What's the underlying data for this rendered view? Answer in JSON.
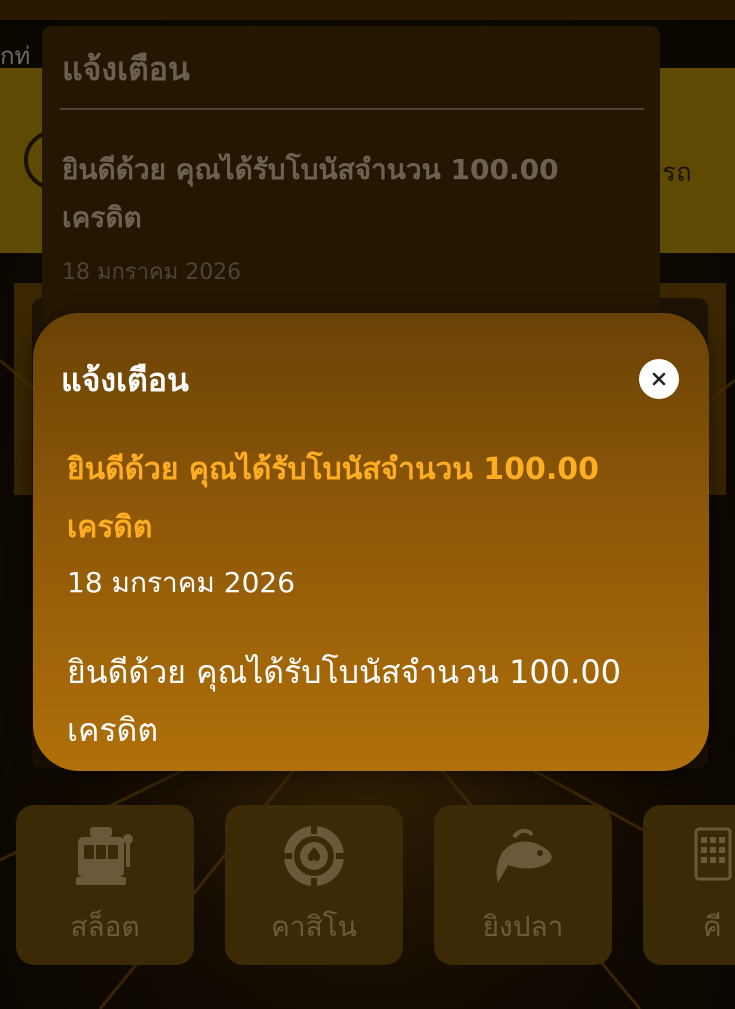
{
  "background_app": {
    "ticker_text": "กท่",
    "band_right_text": "รถ",
    "game_tabs": [
      {
        "label": "สล็อต",
        "icon": "slot-machine-icon"
      },
      {
        "label": "คาสิโน",
        "icon": "casino-chip-icon"
      },
      {
        "label": "ยิงปลา",
        "icon": "fish-icon"
      },
      {
        "label": "คี",
        "icon": "keno-board-icon"
      }
    ]
  },
  "back_notification": {
    "title": "แจ้งเตือน",
    "message": "ยินดีด้วย คุณได้รับโบนัสจำนวน 100.00 เครดิต",
    "date": "18 มกราคม 2026"
  },
  "modal": {
    "title": "แจ้งเตือน",
    "close_icon": "close-icon",
    "message_title": "ยินดีด้วย คุณได้รับโบนัสจำนวน 100.00 เครดิต",
    "date": "18 มกราคม 2026",
    "body": "ยินดีด้วย คุณได้รับโบนัสจำนวน 100.00 เครดิต"
  },
  "colors": {
    "modal_gradient_top": "#6a4206",
    "modal_gradient_bottom": "#b0700a",
    "accent_orange": "#ffae22",
    "text_white": "#ffffff"
  }
}
